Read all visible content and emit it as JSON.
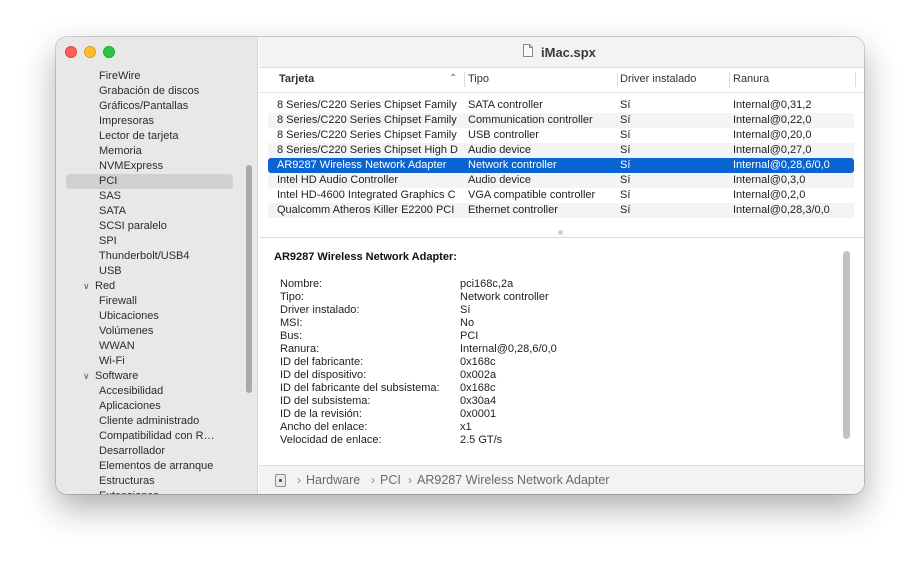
{
  "window": {
    "title": "iMac.spx"
  },
  "sidebar": {
    "items": [
      {
        "label": "FireWire",
        "kind": "item"
      },
      {
        "label": "Grabación de discos",
        "kind": "item"
      },
      {
        "label": "Gráficos/Pantallas",
        "kind": "item"
      },
      {
        "label": "Impresoras",
        "kind": "item"
      },
      {
        "label": "Lector de tarjeta",
        "kind": "item"
      },
      {
        "label": "Memoria",
        "kind": "item"
      },
      {
        "label": "NVMExpress",
        "kind": "item"
      },
      {
        "label": "PCI",
        "kind": "item",
        "selected": true
      },
      {
        "label": "SAS",
        "kind": "item"
      },
      {
        "label": "SATA",
        "kind": "item"
      },
      {
        "label": "SCSI paralelo",
        "kind": "item"
      },
      {
        "label": "SPI",
        "kind": "item"
      },
      {
        "label": "Thunderbolt/USB4",
        "kind": "item"
      },
      {
        "label": "USB",
        "kind": "item"
      },
      {
        "label": "Red",
        "kind": "group"
      },
      {
        "label": "Firewall",
        "kind": "item"
      },
      {
        "label": "Ubicaciones",
        "kind": "item"
      },
      {
        "label": "Volúmenes",
        "kind": "item"
      },
      {
        "label": "WWAN",
        "kind": "item"
      },
      {
        "label": "Wi-Fi",
        "kind": "item"
      },
      {
        "label": "Software",
        "kind": "group"
      },
      {
        "label": "Accesibilidad",
        "kind": "item"
      },
      {
        "label": "Aplicaciones",
        "kind": "item"
      },
      {
        "label": "Cliente administrado",
        "kind": "item"
      },
      {
        "label": "Compatibilidad con R…",
        "kind": "item"
      },
      {
        "label": "Desarrollador",
        "kind": "item"
      },
      {
        "label": "Elementos de arranque",
        "kind": "item"
      },
      {
        "label": "Estructuras",
        "kind": "item"
      },
      {
        "label": "Extensiones",
        "kind": "item"
      }
    ]
  },
  "table": {
    "columns": [
      "Tarjeta",
      "Tipo",
      "Driver instalado",
      "Ranura"
    ],
    "rows": [
      [
        "8 Series/C220 Series Chipset Family",
        "SATA controller",
        "Sí",
        "Internal@0,31,2"
      ],
      [
        "8 Series/C220 Series Chipset Family",
        "Communication controller",
        "Sí",
        "Internal@0,22,0"
      ],
      [
        "8 Series/C220 Series Chipset Family",
        "USB controller",
        "Sí",
        "Internal@0,20,0"
      ],
      [
        "8 Series/C220 Series Chipset High D",
        "Audio device",
        "Sí",
        "Internal@0,27,0"
      ],
      [
        "AR9287 Wireless Network Adapter",
        "Network controller",
        "Sí",
        "Internal@0,28,6/0,0"
      ],
      [
        "Intel HD Audio Controller",
        "Audio device",
        "Sí",
        "Internal@0,3,0"
      ],
      [
        "Intel HD-4600 Integrated Graphics C",
        "VGA compatible controller",
        "Sí",
        "Internal@0,2,0"
      ],
      [
        "Qualcomm Atheros Killer E2200 PCI",
        "Ethernet controller",
        "Sí",
        "Internal@0,28,3/0,0"
      ]
    ],
    "selected_row": 4
  },
  "detail": {
    "title": "AR9287 Wireless Network Adapter:",
    "fields": [
      {
        "label": "Nombre:",
        "value": "pci168c,2a"
      },
      {
        "label": "Tipo:",
        "value": "Network controller"
      },
      {
        "label": "Driver instalado:",
        "value": "Sí"
      },
      {
        "label": "MSI:",
        "value": "No"
      },
      {
        "label": "Bus:",
        "value": "PCI"
      },
      {
        "label": "Ranura:",
        "value": "Internal@0,28,6/0,0"
      },
      {
        "label": "ID del fabricante:",
        "value": "0x168c"
      },
      {
        "label": "ID del dispositivo:",
        "value": "0x002a"
      },
      {
        "label": "ID del fabricante del subsistema:",
        "value": "0x168c"
      },
      {
        "label": "ID del subsistema:",
        "value": "0x30a4"
      },
      {
        "label": "ID de la revisión:",
        "value": "0x0001"
      },
      {
        "label": "Ancho del enlace:",
        "value": "x1"
      },
      {
        "label": "Velocidad de enlace:",
        "value": "2.5 GT/s"
      }
    ]
  },
  "pathbar": {
    "icon": "hardware-chip-icon",
    "crumbs": [
      "Hardware",
      "PCI",
      "AR9287 Wireless Network Adapter"
    ]
  },
  "colors": {
    "selection": "#0a64d2",
    "sidebar_bg": "#e8e8e8",
    "close": "#fe5f57",
    "minimize": "#febc2e",
    "zoom": "#28c840"
  }
}
